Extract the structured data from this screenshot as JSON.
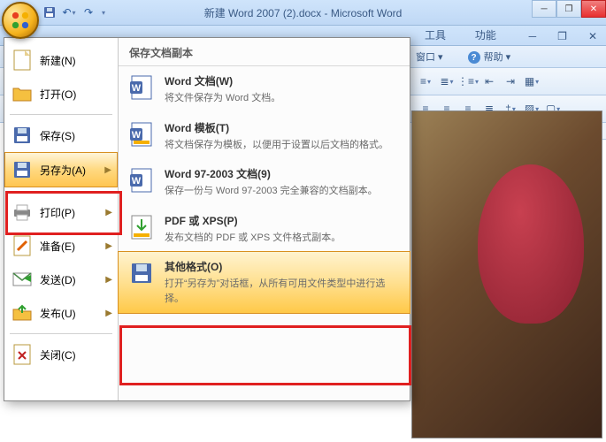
{
  "title": "新建 Word 2007 (2).docx - Microsoft Word",
  "qat": {
    "save": "保存",
    "undo": "撤销",
    "redo": "重做"
  },
  "win": {
    "min": "最小化",
    "max": "还原",
    "close": "关闭"
  },
  "tabs": {
    "dev": "开发工具",
    "special": "特色功能"
  },
  "subrow": {
    "window": "窗口",
    "help": "帮助"
  },
  "menu": {
    "new": "新建(N)",
    "open": "打开(O)",
    "save": "保存(S)",
    "saveas": "另存为(A)",
    "print": "打印(P)",
    "prepare": "准备(E)",
    "send": "发送(D)",
    "publish": "发布(U)",
    "close": "关闭(C)"
  },
  "right_header": "保存文档副本",
  "right_items": [
    {
      "title": "Word 文档(W)",
      "desc": "将文件保存为 Word 文档。"
    },
    {
      "title": "Word 模板(T)",
      "desc": "将文档保存为模板，以便用于设置以后文档的格式。"
    },
    {
      "title": "Word 97-2003 文档(9)",
      "desc": "保存一份与 Word 97-2003 完全兼容的文档副本。"
    },
    {
      "title": "PDF 或 XPS(P)",
      "desc": "发布文档的 PDF 或 XPS 文件格式副本。"
    },
    {
      "title": "其他格式(O)",
      "desc": "打开“另存为”对话框，从所有可用文件类型中进行选择。"
    }
  ]
}
